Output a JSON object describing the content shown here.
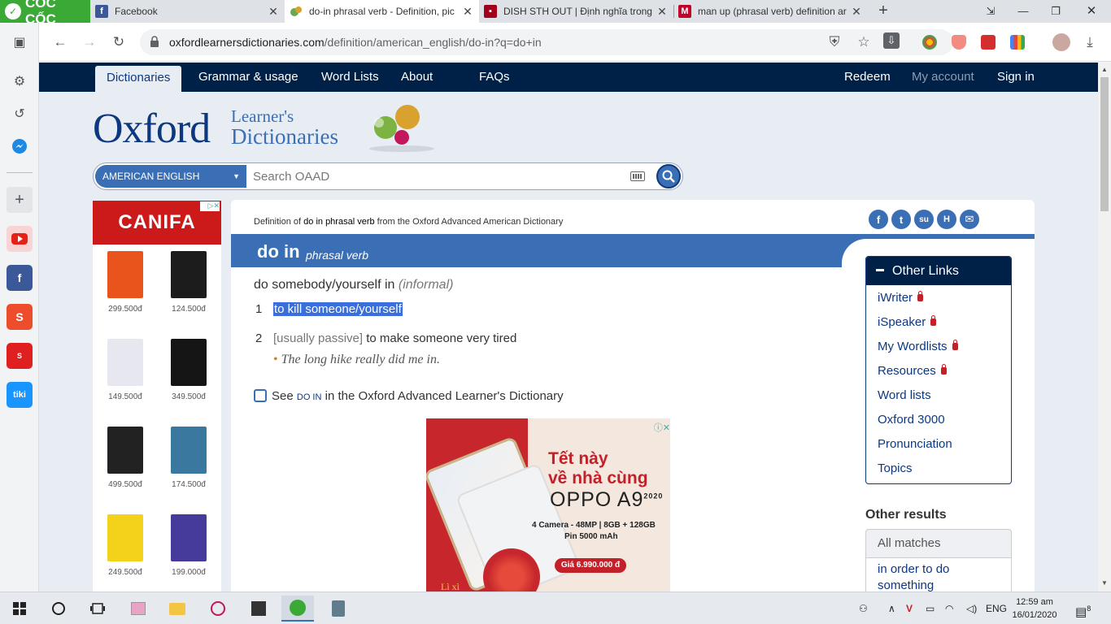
{
  "browser": {
    "brand": "CỐC CỐC",
    "tabs": [
      {
        "title": "Facebook",
        "favicon": "facebook-icon",
        "color": "#3b5998"
      },
      {
        "title": "do-in phrasal verb - Definition, pic",
        "favicon": "oald-icon",
        "color": "#6aa84f"
      },
      {
        "title": "DISH STH OUT | Định nghĩa trong",
        "favicon": "cambridge-icon",
        "color": "#a3001e"
      },
      {
        "title": "man up (phrasal verb) definition ar",
        "favicon": "macmillan-icon",
        "color": "#c0002b"
      }
    ],
    "url_host": "oxfordlearnersdictionaries.com",
    "url_path": "/definition/american_english/do-in?q=do+in"
  },
  "site": {
    "nav_left": [
      "Dictionaries",
      "Grammar & usage",
      "Word Lists",
      "About",
      "FAQs"
    ],
    "nav_right": [
      "Redeem",
      "My account",
      "Sign in"
    ],
    "logo_oxford": "Oxford",
    "logo_learners": "Learner's",
    "logo_dictionaries": "Dictionaries",
    "search": {
      "dictionary": "AMERICAN ENGLISH",
      "placeholder": "Search OAAD"
    }
  },
  "ad_left": {
    "brand": "CANIFA",
    "products": [
      {
        "price": "299.500đ",
        "color": "#e8541c"
      },
      {
        "price": "124.500đ",
        "color": "#1c1c1c"
      },
      {
        "price": "149.500đ",
        "color": "#e7e7ef"
      },
      {
        "price": "349.500đ",
        "color": "#151515"
      },
      {
        "price": "499.500đ",
        "color": "#222222"
      },
      {
        "price": "174.500đ",
        "color": "#3a78a0"
      },
      {
        "price": "249.500đ",
        "color": "#f2d21b"
      },
      {
        "price": "199.000đ",
        "color": "#463a9a"
      }
    ]
  },
  "entry": {
    "source_prefix": "Definition of",
    "source_word": "do in phrasal verb",
    "source_suffix": "from the Oxford Advanced American Dictionary",
    "headword": "do in",
    "pos": "phrasal verb",
    "idiom": "do somebody/yourself in",
    "idiom_label": "(informal)",
    "senses": [
      {
        "num": "1",
        "text": "to kill someone/yourself"
      },
      {
        "num": "2",
        "gram": "[usually passive]",
        "text": "to make someone very tired"
      }
    ],
    "example": "The long hike really did me in.",
    "see_also_prefix": "See",
    "see_also_word": "do in",
    "see_also_suffix": "in the Oxford Advanced Learner's Dictionary"
  },
  "ad_oppo": {
    "line1": "Tết này",
    "line2": "về nhà cùng",
    "model": "OPPO A9",
    "year": "2020",
    "spec1": "4 Camera - 48MP  |  8GB + 128GB",
    "spec2": "Pin 5000 mAh",
    "price": "Giá 6.990.000 đ",
    "lixi": "Lì xì"
  },
  "other_links": {
    "title": "Other Links",
    "items": [
      {
        "label": "iWriter",
        "locked": true
      },
      {
        "label": "iSpeaker",
        "locked": true
      },
      {
        "label": "My Wordlists",
        "locked": true
      },
      {
        "label": "Resources",
        "locked": true
      },
      {
        "label": "Word lists",
        "locked": false
      },
      {
        "label": "Oxford 3000",
        "locked": false
      },
      {
        "label": "Pronunciation",
        "locked": false
      },
      {
        "label": "Topics",
        "locked": false
      }
    ]
  },
  "other_results": {
    "title": "Other results",
    "tab": "All matches",
    "items": [
      "in order to do something"
    ]
  },
  "taskbar": {
    "language": "ENG",
    "time": "12:59 am",
    "date": "16/01/2020",
    "notifications": "8"
  }
}
